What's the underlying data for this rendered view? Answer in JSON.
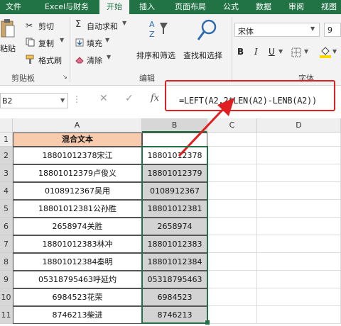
{
  "tabs": [
    "文件",
    "Excel与财务",
    "开始",
    "插入",
    "页面布局",
    "公式",
    "数据",
    "审阅",
    "视图"
  ],
  "clipboard": {
    "cut": "剪切",
    "copy": "复制",
    "paste": "粘贴",
    "format_painter": "格式刷",
    "group": "剪贴板"
  },
  "editing": {
    "autosum": "自动求和",
    "fill": "填充",
    "clear": "清除",
    "sort_filter": "排序和筛选",
    "find_select": "查找和选择",
    "group": "编辑"
  },
  "font": {
    "name": "宋体",
    "size": "9",
    "bold": "B",
    "italic": "I",
    "underline": "U",
    "group": "字体"
  },
  "namebox": "B2",
  "formula": "=LEFT(A2,2*LEN(A2)-LENB(A2))",
  "fx": "fx",
  "columns": [
    "A",
    "B",
    "C",
    "D"
  ],
  "row_numbers": [
    "1",
    "2",
    "3",
    "4",
    "5",
    "6",
    "7",
    "8",
    "9",
    "10",
    "11"
  ],
  "header_a": "混合文本",
  "rows": [
    {
      "a": "18801012378宋江",
      "b": "18801012378"
    },
    {
      "a": "18801012379卢俊义",
      "b": "18801012379"
    },
    {
      "a": "0108912367吴用",
      "b": "0108912367"
    },
    {
      "a": "18801012381公孙胜",
      "b": "18801012381"
    },
    {
      "a": "2658974关胜",
      "b": "2658974"
    },
    {
      "a": "18801012383林冲",
      "b": "18801012383"
    },
    {
      "a": "18801012384秦明",
      "b": "18801012384"
    },
    {
      "a": "05318795463呼延灼",
      "b": "05318795463"
    },
    {
      "a": "6984523花荣",
      "b": "6984523"
    },
    {
      "a": "8746213柴进",
      "b": "8746213"
    }
  ],
  "colors": {
    "ribbon_green": "#217346",
    "header_fill": "#f8cbad",
    "selection_fill": "#d3d3d3",
    "highlight_red": "#e02020"
  }
}
